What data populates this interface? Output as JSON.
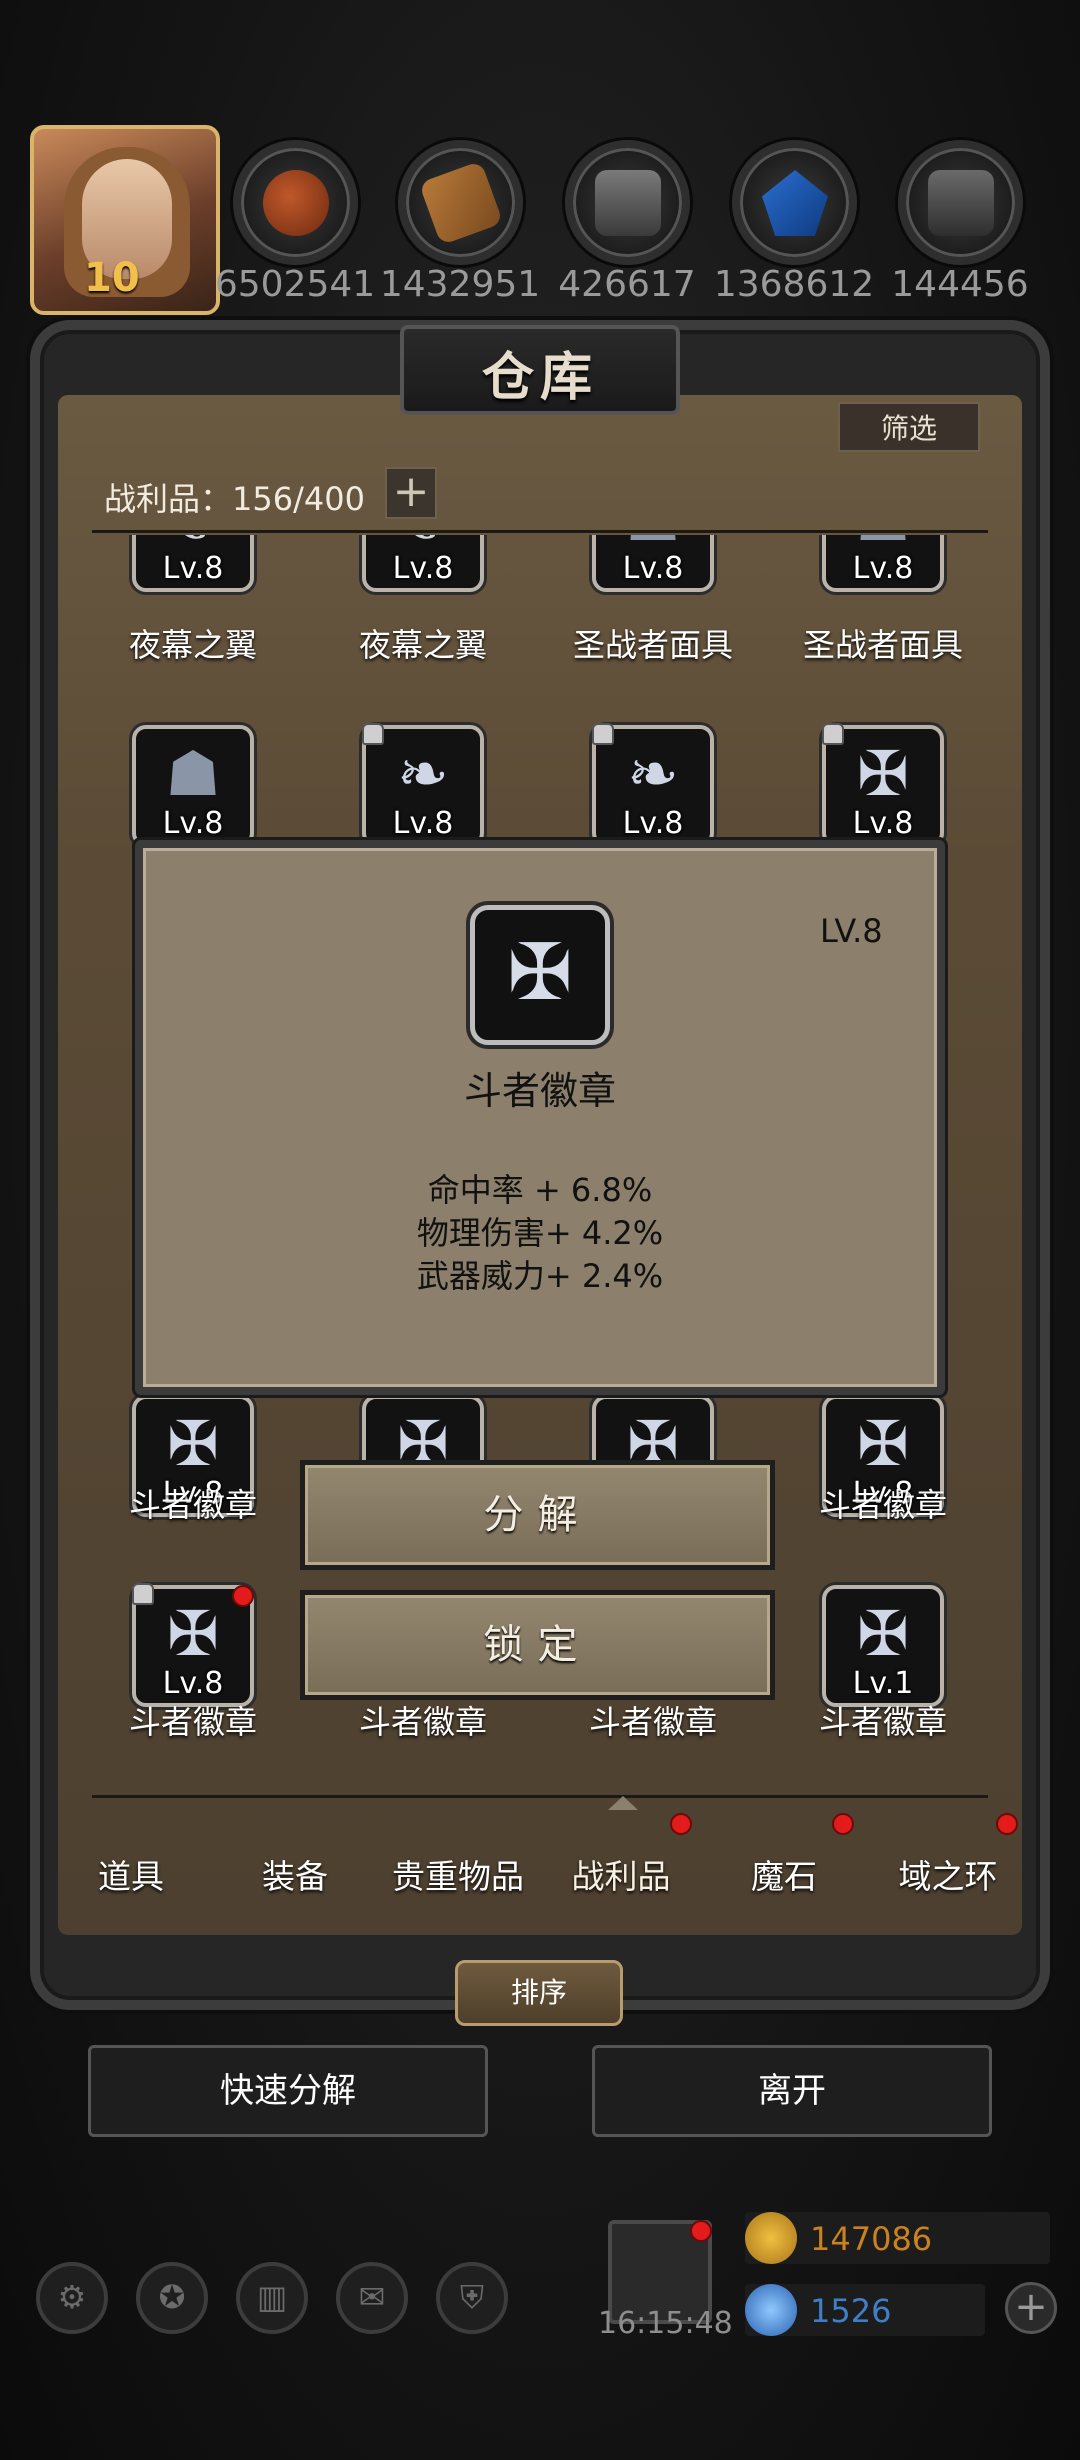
{
  "header": {
    "level": "10",
    "resources": [
      "6502541",
      "1432951",
      "426617",
      "1368612",
      "144456"
    ],
    "resource_icons": [
      "meat-icon",
      "wood-icon",
      "iron-ingot-icon",
      "crystal-icon",
      "stone-icon"
    ]
  },
  "panel": {
    "title": "仓库",
    "filter_label": "筛选",
    "count_label": "战利品：156/400",
    "expand_label": "+"
  },
  "grid": {
    "rows": [
      [
        {
          "level": "Lv.8",
          "name": "夜幕之翼",
          "icon": "wing-icon"
        },
        {
          "level": "Lv.8",
          "name": "夜幕之翼",
          "icon": "wing-icon"
        },
        {
          "level": "Lv.8",
          "name": "圣战者面具",
          "icon": "mask-icon"
        },
        {
          "level": "Lv.8",
          "name": "圣战者面具",
          "icon": "mask-icon"
        }
      ],
      [
        {
          "level": "Lv.8",
          "name": "",
          "icon": "mask-icon"
        },
        {
          "level": "Lv.8",
          "name": "",
          "icon": "feather-icon"
        },
        {
          "level": "Lv.8",
          "name": "",
          "icon": "feather-icon"
        },
        {
          "level": "Lv.8",
          "name": "",
          "icon": "badge-icon"
        }
      ],
      [
        {
          "level": "Lv.8",
          "name": "斗者徽章",
          "icon": "badge-icon"
        },
        {
          "level": "",
          "name": "",
          "icon": "badge-icon"
        },
        {
          "level": "",
          "name": "",
          "icon": "badge-icon"
        },
        {
          "level": "Lv.8",
          "name": "斗者徽章",
          "icon": "badge-icon"
        }
      ],
      [
        {
          "level": "Lv.8",
          "name": "斗者徽章",
          "icon": "badge-icon"
        },
        {
          "level": "",
          "name": "斗者徽章",
          "icon": "badge-icon"
        },
        {
          "level": "",
          "name": "斗者徽章",
          "icon": "badge-icon"
        },
        {
          "level": "Lv.1",
          "name": "斗者徽章",
          "icon": "badge-icon"
        }
      ]
    ]
  },
  "popup": {
    "level": "LV.8",
    "name": "斗者徽章",
    "icon": "badge-icon",
    "stats": [
      "命中率 + 6.8%",
      "物理伤害+ 4.2%",
      "武器威力+ 2.4%"
    ]
  },
  "actions": {
    "decompose_label": "分解",
    "lock_label": "锁定"
  },
  "tabs": [
    "道具",
    "装备",
    "贵重物品",
    "战利品",
    "魔石",
    "域之环"
  ],
  "active_tab": "战利品",
  "footer": {
    "sort_label": "排序",
    "quick_decompose_label": "快速分解",
    "leave_label": "离开"
  },
  "hud": {
    "clock": "16:15:48",
    "gold": "147086",
    "gems": "1526",
    "plus_label": "+"
  },
  "colors": {
    "gold_text": "#c9821f",
    "gem_text": "#3f7fc8",
    "notification_red": "#e41b1b"
  }
}
